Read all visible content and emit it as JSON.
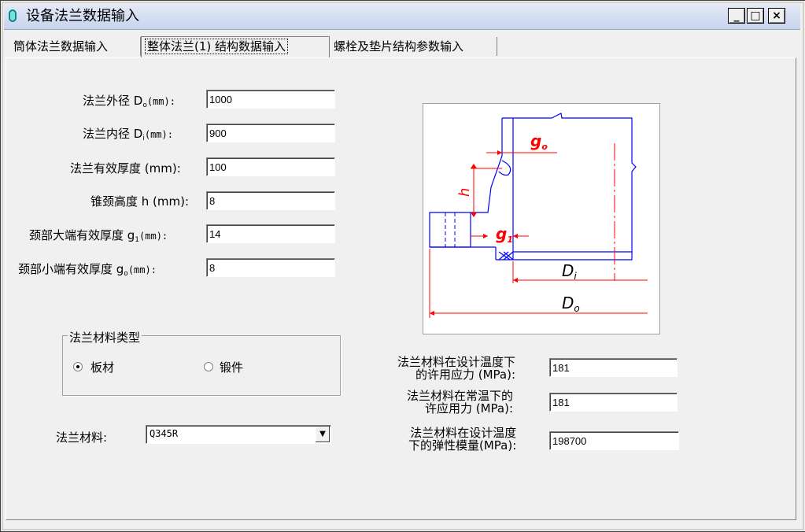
{
  "window": {
    "title": "设备法兰数据输入",
    "minimize": "_",
    "maximize": "□",
    "close": "×"
  },
  "tabs": [
    {
      "label": "筒体法兰数据输入"
    },
    {
      "label": "整体法兰(1) 结构数据输入"
    },
    {
      "label": "螺栓及垫片结构参数输入"
    }
  ],
  "fields": {
    "outer_diameter": {
      "label": "法兰外径 D",
      "sub": "o",
      "unit": "(mm):",
      "value": "1000"
    },
    "inner_diameter": {
      "label": "法兰内径 D",
      "sub": "i",
      "unit": "(mm):",
      "value": "900"
    },
    "thickness": {
      "label": "法兰有效厚度 (mm):",
      "value": "100"
    },
    "neck_height": {
      "label": "锥颈高度 h (mm):",
      "value": "8"
    },
    "neck_large": {
      "label": "颈部大端有效厚度 g",
      "sub": "1",
      "unit": "(mm):",
      "value": "14"
    },
    "neck_small": {
      "label": "颈部小端有效厚度 g",
      "sub": "o",
      "unit": "(mm):",
      "value": "8"
    }
  },
  "material_type": {
    "title": "法兰材料类型",
    "options": [
      {
        "label": "板材",
        "selected": true
      },
      {
        "label": "锻件",
        "selected": false
      }
    ]
  },
  "material": {
    "label": "法兰材料:",
    "value": "Q345R"
  },
  "stresses": {
    "design_allowable": {
      "line1": "法兰材料在设计温度下",
      "line2": "的许用应力 (MPa):",
      "value": "181"
    },
    "normal_allowable": {
      "line1": "法兰材料在常温下的",
      "line2": "许应用力 (MPa):",
      "value": "181"
    },
    "elastic_modulus": {
      "line1": "法兰材料在设计温度",
      "line2": "下的弹性模量(MPa):",
      "value": "198700"
    }
  },
  "diagram": {
    "g0": "g",
    "g0_sub": "o",
    "g1": "g",
    "g1_sub": "1",
    "h": "h",
    "di": "D",
    "di_sub": "i",
    "do": "D",
    "do_sub": "o"
  },
  "colors": {
    "blue_line": "#0000ff",
    "red_line": "#ff0000",
    "title_bg": "#c8d4ee"
  }
}
